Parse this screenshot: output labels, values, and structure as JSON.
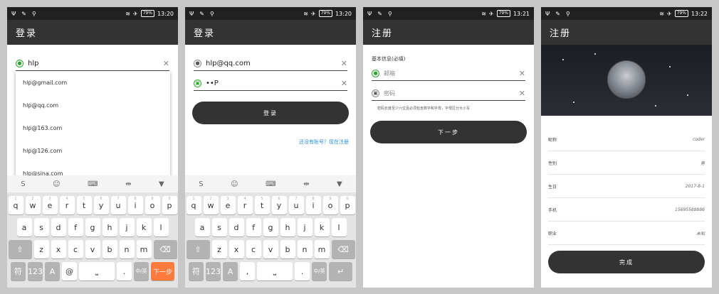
{
  "screens": [
    {
      "status": {
        "time": "13:20",
        "battery": "79%"
      },
      "title": "登录",
      "username": "hlp",
      "suggestions": [
        "hlp@gmail.com",
        "hlp@qq.com",
        "hlp@163.com",
        "hlp@126.com",
        "hlp@sina.com"
      ],
      "keyboard": {
        "action_label": "下一步",
        "lang_label": "中/英",
        "symbol_label": "符",
        "num_label": "123"
      }
    },
    {
      "status": {
        "time": "13:20",
        "battery": "79%"
      },
      "title": "登录",
      "username": "hlp@qq.com",
      "password": "••P",
      "login_button": "登录",
      "register_link": "还没有账号？现在注册",
      "keyboard": {
        "lang_label": "中/英",
        "symbol_label": "符",
        "num_label": "123"
      }
    },
    {
      "status": {
        "time": "13:21",
        "battery": "79%"
      },
      "title": "注册",
      "section": "基本信息(必填)",
      "email_placeholder": "邮箱",
      "password_placeholder": "密码",
      "note": "密码长度至少六位且必须包含数字和字母，字母区分大小写",
      "next_button": "下一步"
    },
    {
      "status": {
        "time": "13:22",
        "battery": "79%"
      },
      "title": "注册",
      "info": [
        {
          "label": "昵称",
          "value": "coder"
        },
        {
          "label": "性别",
          "value": "男"
        },
        {
          "label": "生日",
          "value": "2017-8-1"
        },
        {
          "label": "手机",
          "value": "15695588886"
        },
        {
          "label": "职业",
          "value": "未知"
        }
      ],
      "done_button": "完成"
    }
  ],
  "keys": {
    "row1": [
      "q",
      "w",
      "e",
      "r",
      "t",
      "y",
      "u",
      "i",
      "o",
      "p"
    ],
    "row1_sub": [
      "1",
      "2",
      "3",
      "4",
      "5",
      "6",
      "7",
      "8",
      "9",
      "0"
    ],
    "row2": [
      "a",
      "s",
      "d",
      "f",
      "g",
      "h",
      "j",
      "k",
      "l"
    ],
    "row3": [
      "z",
      "x",
      "c",
      "v",
      "b",
      "n",
      "m"
    ]
  },
  "colors": {
    "appbar": "#333333",
    "accent_green": "#2fa52f",
    "link_blue": "#2a8fd6",
    "orange_key": "#ff7a3d"
  }
}
